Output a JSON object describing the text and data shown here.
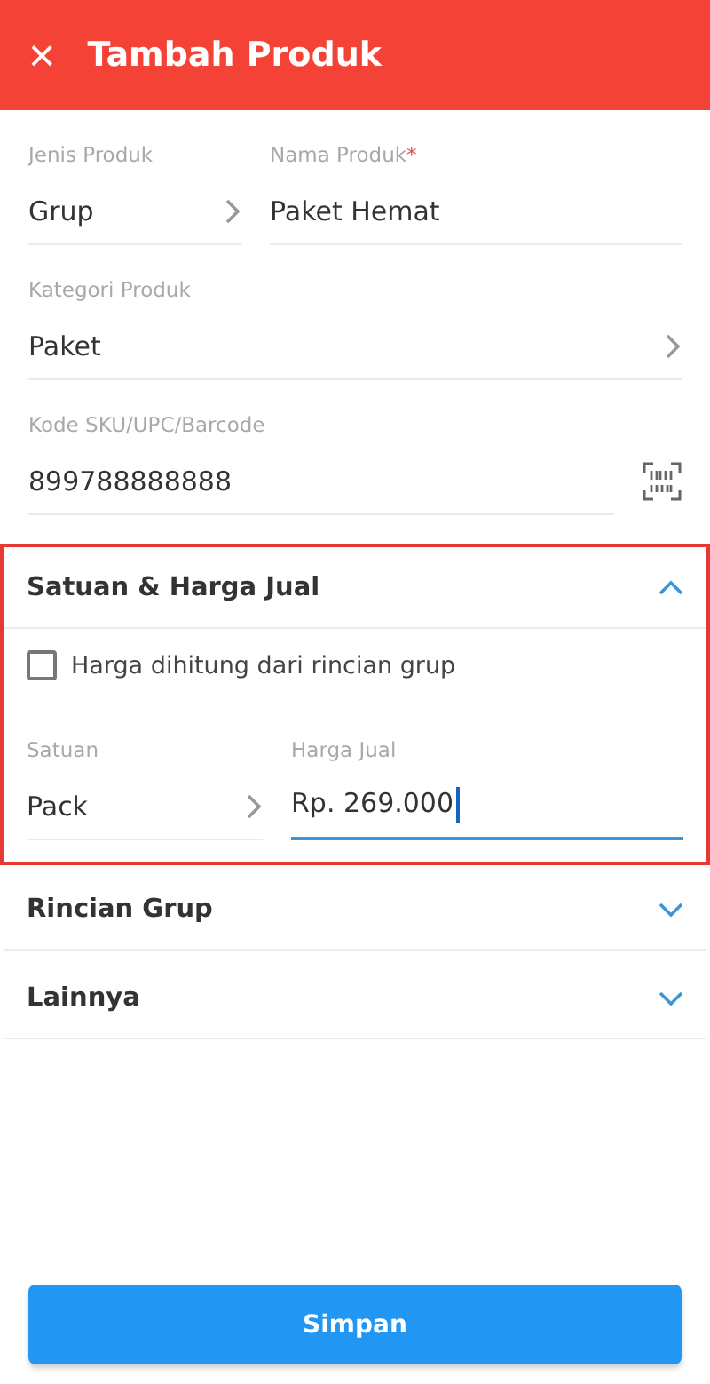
{
  "app_bar": {
    "close_icon": "×",
    "title": "Tambah Produk"
  },
  "fields": {
    "jenis": {
      "label": "Jenis Produk",
      "value": "Grup"
    },
    "nama": {
      "label": "Nama Produk",
      "required_mark": "*",
      "value": "Paket Hemat"
    },
    "kategori": {
      "label": "Kategori Produk",
      "value": "Paket"
    },
    "sku": {
      "label": "Kode SKU/UPC/Barcode",
      "value": "899788888888"
    }
  },
  "sections": [
    {
      "title": "Satuan & Harga Jual",
      "expanded": true,
      "highlighted": true,
      "checkbox": {
        "label": "Harga dihitung dari rincian grup",
        "checked": false
      },
      "satuan": {
        "label": "Satuan",
        "value": "Pack"
      },
      "harga": {
        "label": "Harga Jual",
        "value": "Rp. 269.000",
        "focused": true
      }
    },
    {
      "title": "Rincian Grup",
      "expanded": false,
      "highlighted": false
    },
    {
      "title": "Lainnya",
      "expanded": false,
      "highlighted": false
    }
  ],
  "save_button": "Simpan"
}
